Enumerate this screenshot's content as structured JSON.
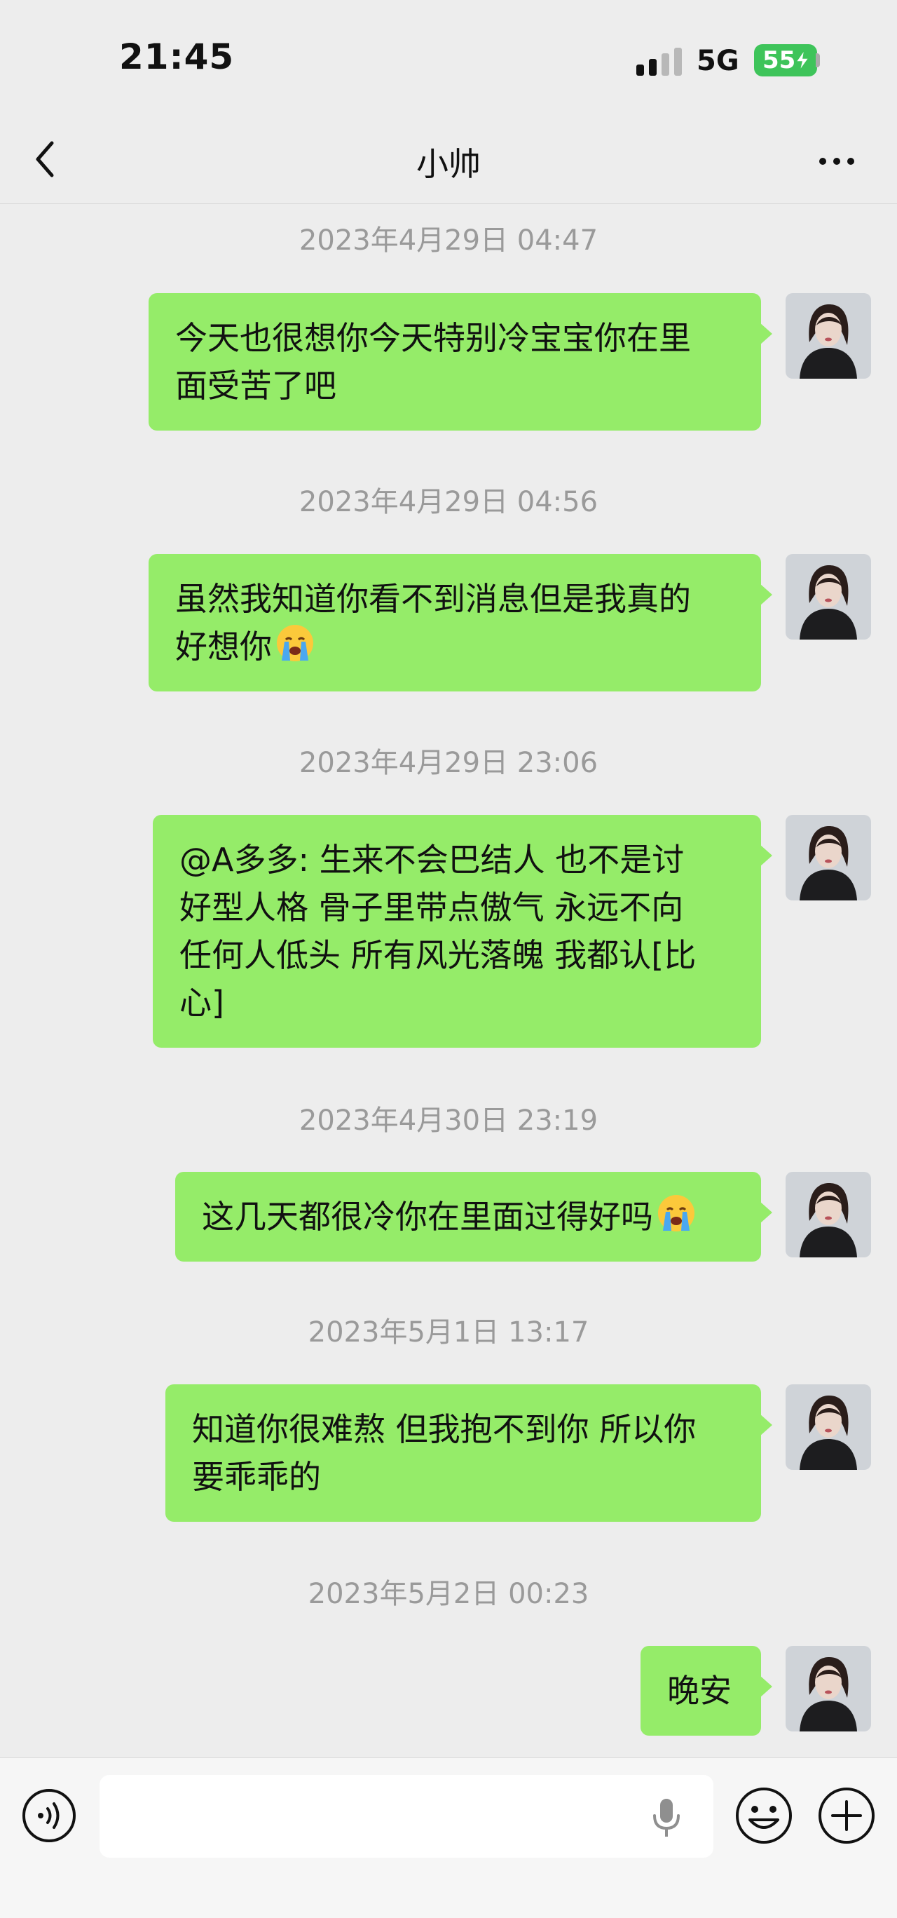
{
  "status": {
    "time": "21:45",
    "network": "5G",
    "battery": "55"
  },
  "header": {
    "title": "小帅",
    "back_icon": "chevron-left-icon",
    "more_icon": "more-dots-icon"
  },
  "messages": [
    {
      "timestamp": "2023年4月29日 04:47",
      "text": "今天也很想你今天特别冷宝宝你在里\n面受苦了吧",
      "emoji": ""
    },
    {
      "timestamp": "2023年4月29日 04:56",
      "text": "虽然我知道你看不到消息但是我真的\n好想你",
      "emoji": "crying-face-icon"
    },
    {
      "timestamp": "2023年4月29日 23:06",
      "text": "@A多多: 生来不会巴结人 也不是讨\n好型人格 骨子里带点傲气 永远不向\n任何人低头 所有风光落魄 我都认[比\n心]",
      "emoji": ""
    },
    {
      "timestamp": "2023年4月30日 23:19",
      "text": "这几天都很冷你在里面过得好吗",
      "emoji": "crying-face-icon"
    },
    {
      "timestamp": "2023年5月1日 13:17",
      "text": "知道你很难熬 但我抱不到你 所以你\n要乖乖的",
      "emoji": ""
    },
    {
      "timestamp": "2023年5月2日 00:23",
      "text": "晚安",
      "emoji": ""
    }
  ],
  "input": {
    "placeholder": "",
    "voice_icon": "voice-mode-icon",
    "mic_icon": "microphone-icon",
    "emoji_icon": "emoji-icon",
    "plus_icon": "plus-icon"
  },
  "colors": {
    "background": "#ededed",
    "bubble": "#95ec69",
    "battery": "#3ec45a",
    "timestamp": "#9a9a9a"
  }
}
